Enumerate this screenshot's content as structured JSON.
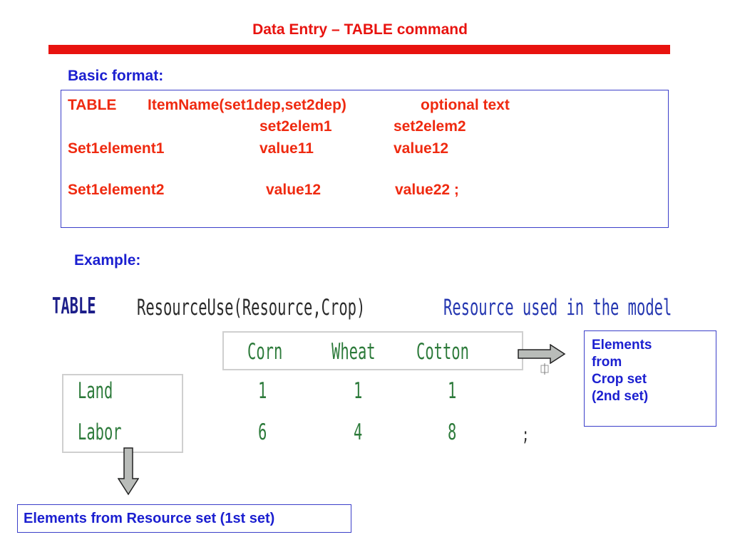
{
  "slide": {
    "title": "Data Entry – TABLE command"
  },
  "basic_format": {
    "heading": "Basic format:",
    "line1": {
      "kw": "TABLE",
      "item": "ItemName(set1dep,set2dep)",
      "text": "optional text"
    },
    "line2": {
      "c1": "set2elem1",
      "c2": "set2elem2"
    },
    "line3": {
      "row": "Set1element1",
      "v1": "value11",
      "v2": "value12"
    },
    "line4": {
      "row": "Set1element2",
      "v1": "value12",
      "v2": "value22 ;"
    }
  },
  "example": {
    "heading": "Example:",
    "keyword": "TABLE",
    "declaration": "ResourceUse(Resource,Crop)",
    "description": "Resource used in the model",
    "columns": [
      "Corn",
      "Wheat",
      "Cotton"
    ],
    "rows": [
      {
        "label": "Land",
        "values": [
          "1",
          "1",
          "1"
        ]
      },
      {
        "label": "Labor",
        "values": [
          "6",
          "4",
          "8"
        ]
      }
    ],
    "terminator": ";"
  },
  "callouts": {
    "crop": [
      "Elements",
      "from",
      "Crop set",
      "(2nd set)"
    ],
    "resource": "Elements from Resource set (1st set)"
  },
  "colors": {
    "accent_red": "#e8130f",
    "heading_blue": "#1b1fd0",
    "code_green": "#2c7a3a"
  }
}
